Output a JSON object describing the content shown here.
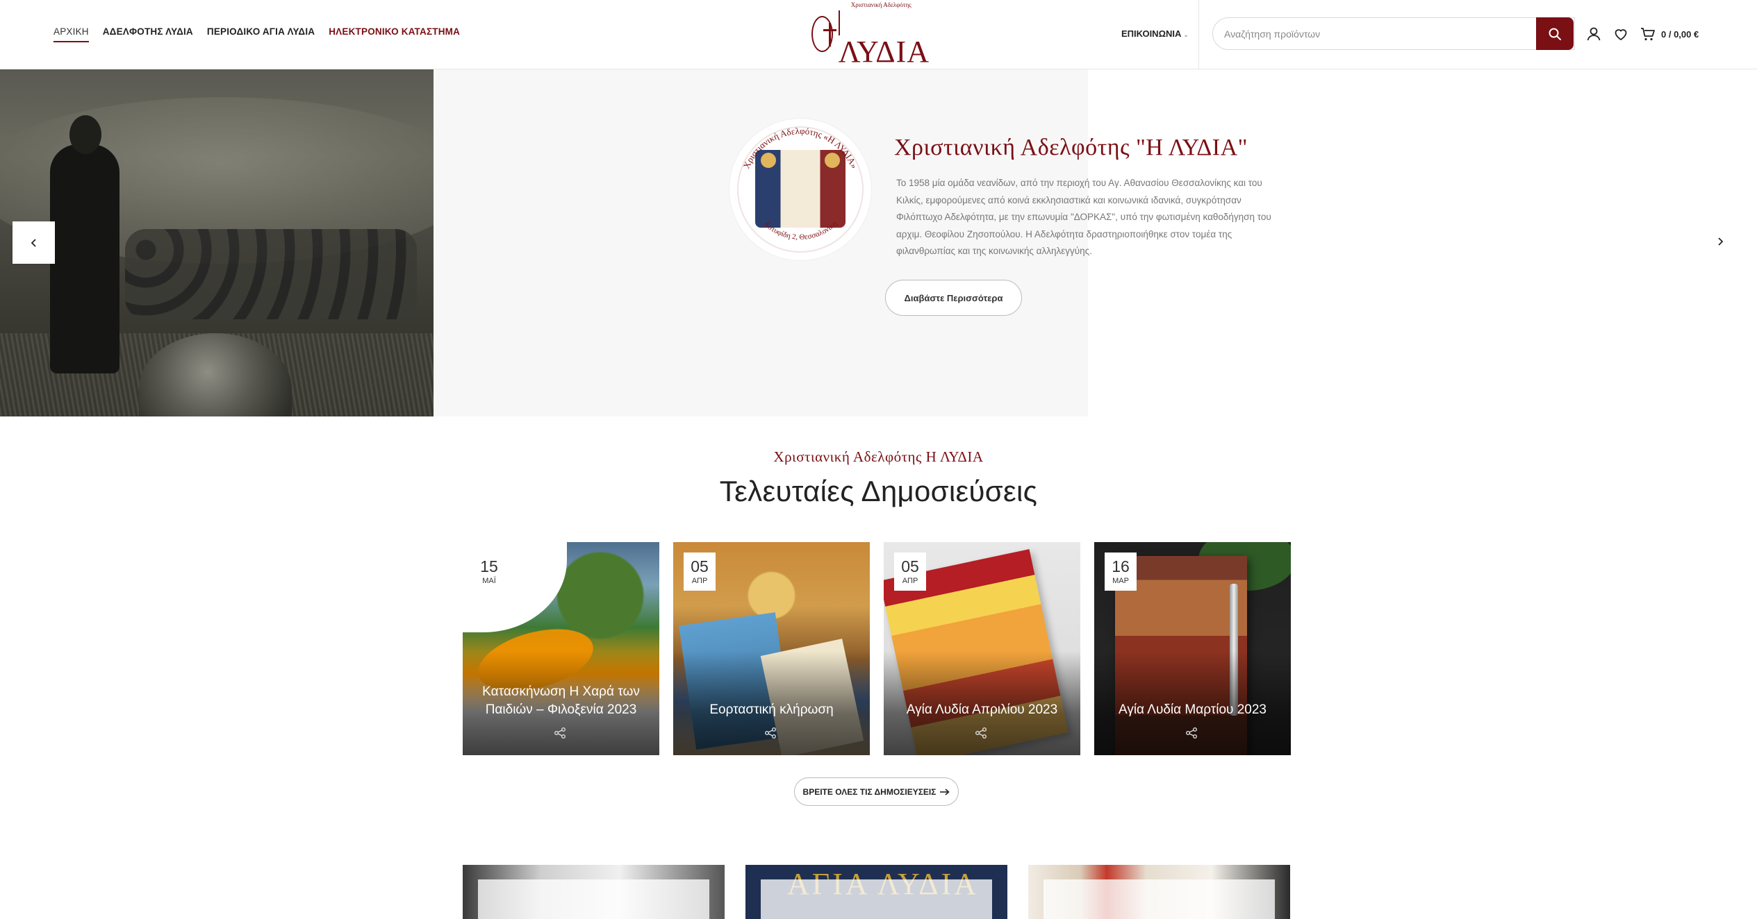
{
  "nav": {
    "items": [
      {
        "label": "ΑΡΧΙΚΗ"
      },
      {
        "label": "ΑΔΕΛΦΟΤΗΣ ΛΥΔΙΑ"
      },
      {
        "label": "ΠΕΡΙΟΔΙΚΟ ΑΓΙΑ ΛΥΔΙΑ"
      },
      {
        "label": "ΗΛΕΚΤΡΟΝΙΚΟ ΚΑΤΑΣΤΗΜΑ"
      }
    ]
  },
  "logo": {
    "small": "Χριστιανική Αδελφότης",
    "big": "ΛΥΔΙΑ"
  },
  "header": {
    "contact": "ΕΠΙΚΟΙΝΩΝΙΑ",
    "search_placeholder": "Αναζήτηση προϊόντων",
    "cart_total": "0 / 0,00 €"
  },
  "hero": {
    "badge_top": "Χριστιανική Αδελφότης «Η ΛΥΔΙΑ»",
    "badge_bottom": "Αστυφίδη 2, Θεσσαλονίκη",
    "title": "Χριστιανική Αδελφότης \"Η ΛΥΔΙΑ\"",
    "description": "Το 1958 μία ομάδα νεανίδων, από την περιοχή του Αγ. Αθανασίου Θεσσαλονίκης και του Κιλκίς, εμφορούμενες από κοινά εκκλησιαστικά και κοινωνικά ιδανικά, συγκρότησαν Φιλόπτωχο Αδελφότητα, με την επωνυμία \"ΔΟΡΚΑΣ\", υπό την φωτισμένη καθοδήγηση του αρχιμ. Θεοφίλου Ζησοπούλου. Η Αδελφότητα δραστηριοποιήθηκε στον τομέα της φιλανθρωπίας και της κοινωνικής αλληλεγγύης.",
    "button": "Διαβάστε Περισσότερα"
  },
  "section": {
    "subtitle": "Χριστιανική Αδελφότης Η ΛΥΔΙΑ",
    "title": "Τελευταίες Δημοσιεύσεις"
  },
  "posts": [
    {
      "day": "15",
      "month": "ΜΑΪ",
      "title": "Κατασκήνωση Η Χαρά των Παιδιών – Φιλοξενία 2023"
    },
    {
      "day": "05",
      "month": "ΑΠΡ",
      "title": "Εορταστική κλήρωση"
    },
    {
      "day": "05",
      "month": "ΑΠΡ",
      "title": "Αγία Λυδία Απριλίου 2023"
    },
    {
      "day": "16",
      "month": "ΜΑΡ",
      "title": "Αγία Λυδία Μαρτίου 2023"
    }
  ],
  "all_posts_button": "ΒΡΕΙΤΕ ΟΛΕΣ ΤΙΣ ΔΗΜΟΣΙΕΥΣΕΙΣ",
  "bottom": {
    "magazine_word": "ΑΓΙΑ ΛΥΔΙΑ"
  },
  "colors": {
    "accent": "#7a0f14"
  }
}
